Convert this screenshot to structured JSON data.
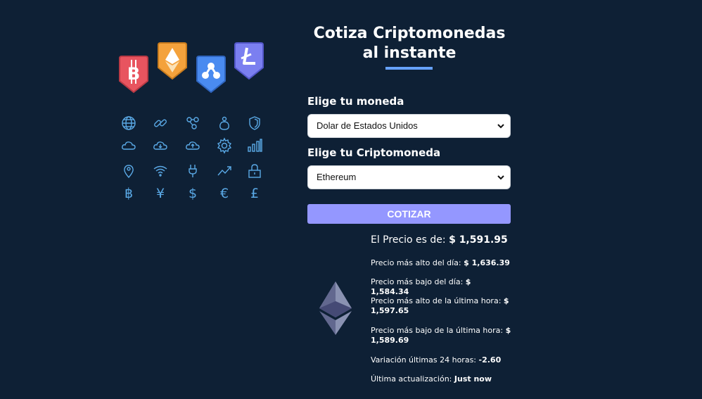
{
  "header": {
    "title": "Cotiza Criptomonedas al instante"
  },
  "form": {
    "currency_label": "Elige tu moneda",
    "currency_selected": "Dolar de Estados Unidos",
    "crypto_label": "Elige tu Criptomoneda",
    "crypto_selected": "Ethereum",
    "submit_label": "COTIZAR"
  },
  "result": {
    "price_label": "El Precio es de:",
    "price_value": "$ 1,591.95",
    "high_day_label": "Precio más alto del día:",
    "high_day_value": "$ 1,636.39",
    "low_day_label": "Precio más bajo del día:",
    "low_day_value": "$ 1,584.34",
    "high_hour_label": "Precio más alto de la última hora:",
    "high_hour_value": "$ 1,597.65",
    "low_hour_label": "Precio más bajo de la última hora:",
    "low_hour_value": "$ 1,589.69",
    "change_label": "Variación últimas 24 horas:",
    "change_value": "-2.60",
    "updated_label": "Última actualización:",
    "updated_value": "Just now"
  },
  "illustration": {
    "badges": [
      "bitcoin-badge",
      "ethereum-badge",
      "ripple-badge",
      "litecoin-badge"
    ],
    "currency_glyphs": [
      "฿",
      "¥",
      "$",
      "€",
      "£"
    ]
  },
  "colors": {
    "background": "#0e2035",
    "accent": "#66a2fe",
    "button": "#9497ff",
    "icon": "#5aa9e6"
  }
}
